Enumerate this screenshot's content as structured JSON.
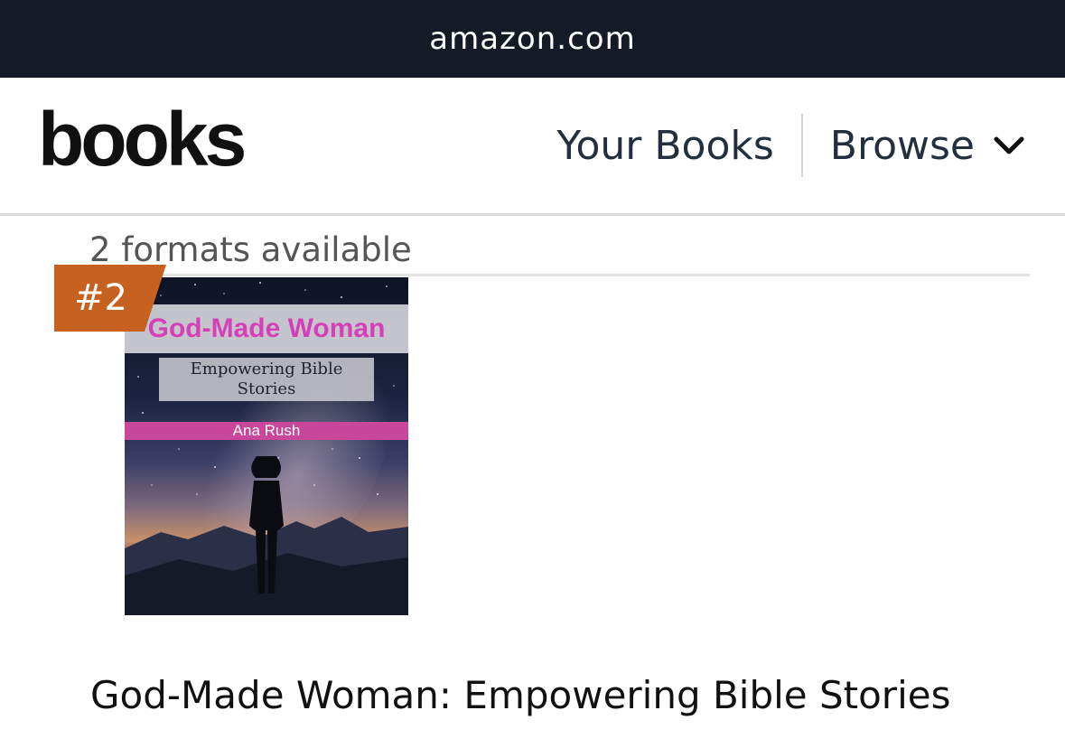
{
  "browser": {
    "url": "amazon.com"
  },
  "header": {
    "logo": "books",
    "nav": {
      "your_books": "Your Books",
      "browse": "Browse"
    },
    "icons": {
      "browse_chevron": "chevron-down-icon"
    }
  },
  "product": {
    "formats_label": "2 formats available",
    "rank_badge": "#2",
    "cover": {
      "title": "God-Made Woman",
      "subtitle": "Empowering Bible Stories",
      "author": "Ana Rush"
    },
    "title": "God-Made Woman: Empowering Bible Stories"
  },
  "colors": {
    "top_bar": "#151b26",
    "badge": "#c7611f",
    "nav_text": "#232f3e",
    "cover_title": "#d63fb8",
    "author_band": "#c8479a"
  }
}
